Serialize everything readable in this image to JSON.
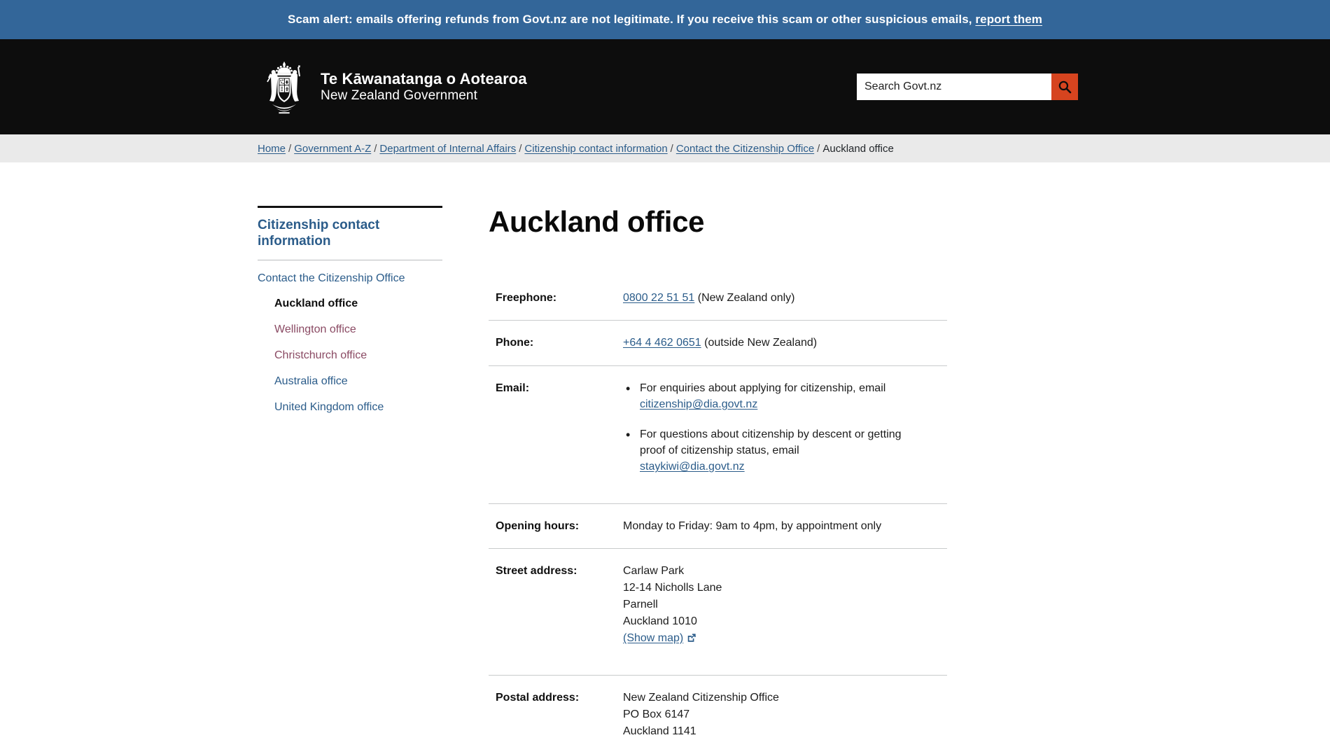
{
  "alert": {
    "text": "Scam alert: emails offering refunds from Govt.nz are not legitimate. If you receive this scam or other suspicious emails, ",
    "link_label": "report them"
  },
  "masthead": {
    "logo_icon": "nz-coat-of-arms-icon",
    "brand_maori": "Te Kāwanatanga o Aotearoa",
    "brand_english": "New Zealand Government",
    "search": {
      "placeholder": "Search Govt.nz",
      "value": "",
      "button_icon": "search-icon",
      "button_color": "#d6441f"
    }
  },
  "breadcrumb": {
    "separator": "/",
    "items": [
      {
        "label": "Home",
        "current": false
      },
      {
        "label": "Government A-Z",
        "current": false
      },
      {
        "label": "Department of Internal Affairs",
        "current": false
      },
      {
        "label": "Citizenship contact information",
        "current": false
      },
      {
        "label": "Contact the Citizenship Office",
        "current": false
      },
      {
        "label": "Auckland office",
        "current": true
      }
    ]
  },
  "sidebar": {
    "title": "Citizenship contact information",
    "items": [
      {
        "label": "Contact the Citizenship Office",
        "level": 1,
        "state": "default"
      },
      {
        "label": "Auckland office",
        "level": 2,
        "state": "current"
      },
      {
        "label": "Wellington office",
        "level": 2,
        "state": "visited"
      },
      {
        "label": "Christchurch office",
        "level": 2,
        "state": "visited"
      },
      {
        "label": "Australia office",
        "level": 2,
        "state": "default"
      },
      {
        "label": "United Kingdom office",
        "level": 2,
        "state": "default"
      }
    ]
  },
  "main": {
    "title": "Auckland office",
    "rows": {
      "freephone": {
        "label": "Freephone:",
        "link": "0800 22 51 51",
        "suffix": " (New Zealand only)"
      },
      "phone": {
        "label": "Phone:",
        "link": "+64 4 462 0651",
        "suffix": " (outside New Zealand)"
      },
      "email": {
        "label": "Email:",
        "bullets": [
          {
            "text_before": "For enquiries about applying for citizenship, email ",
            "link": "citizenship@dia.govt.nz",
            "text_after": ""
          },
          {
            "text_before": "For questions about citizenship by descent or getting proof of citizenship status, email ",
            "link": "staykiwi@dia.govt.nz",
            "text_after": ""
          }
        ]
      },
      "opening_hours": {
        "label": "Opening hours:",
        "value": "Monday to Friday: 9am to 4pm, by appointment only"
      },
      "street_address": {
        "label": "Street address:",
        "lines": [
          "Carlaw Park",
          "12-14 Nicholls Lane",
          "Parnell",
          "Auckland 1010"
        ],
        "map_link": "(Show map)",
        "map_link_icon": "external-link-icon"
      },
      "postal_address": {
        "label": "Postal address:",
        "lines": [
          "New Zealand Citizenship Office",
          "PO Box 6147",
          "Auckland 1141"
        ]
      }
    }
  },
  "colors": {
    "alert_bg": "#336699",
    "masthead_bg": "#0d0d0d",
    "breadcrumb_bg": "#eaeaea",
    "link": "#2b5c8a",
    "visited_link": "#8a4a63",
    "accent": "#d6441f"
  }
}
